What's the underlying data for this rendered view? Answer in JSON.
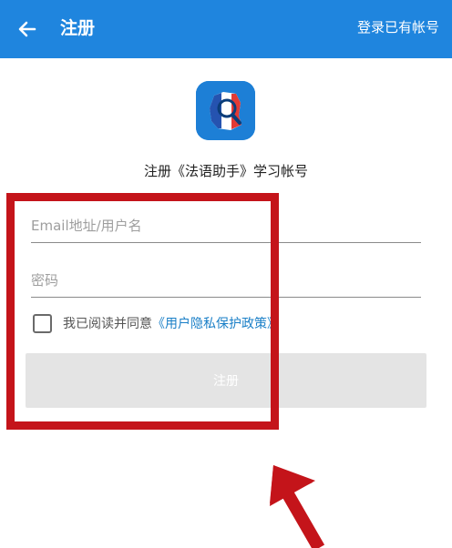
{
  "colors": {
    "accent": "#1f85de",
    "link": "#1a7fc7",
    "annotation": "#c4141a",
    "button_disabled": "#e4e4e4"
  },
  "header": {
    "back_icon": "arrow-left-icon",
    "title": "注册",
    "action_label": "登录已有帐号"
  },
  "app": {
    "logo_icon": "france-map-magnifier-icon",
    "title": "注册《法语助手》学习帐号"
  },
  "form": {
    "email_placeholder": "Email地址/用户名",
    "email_value": "",
    "password_placeholder": "密码",
    "password_value": "",
    "agree_checked": false,
    "agree_text": "我已阅读并同意",
    "policy_link": "《用户隐私保护政策》",
    "register_label": "注册"
  }
}
